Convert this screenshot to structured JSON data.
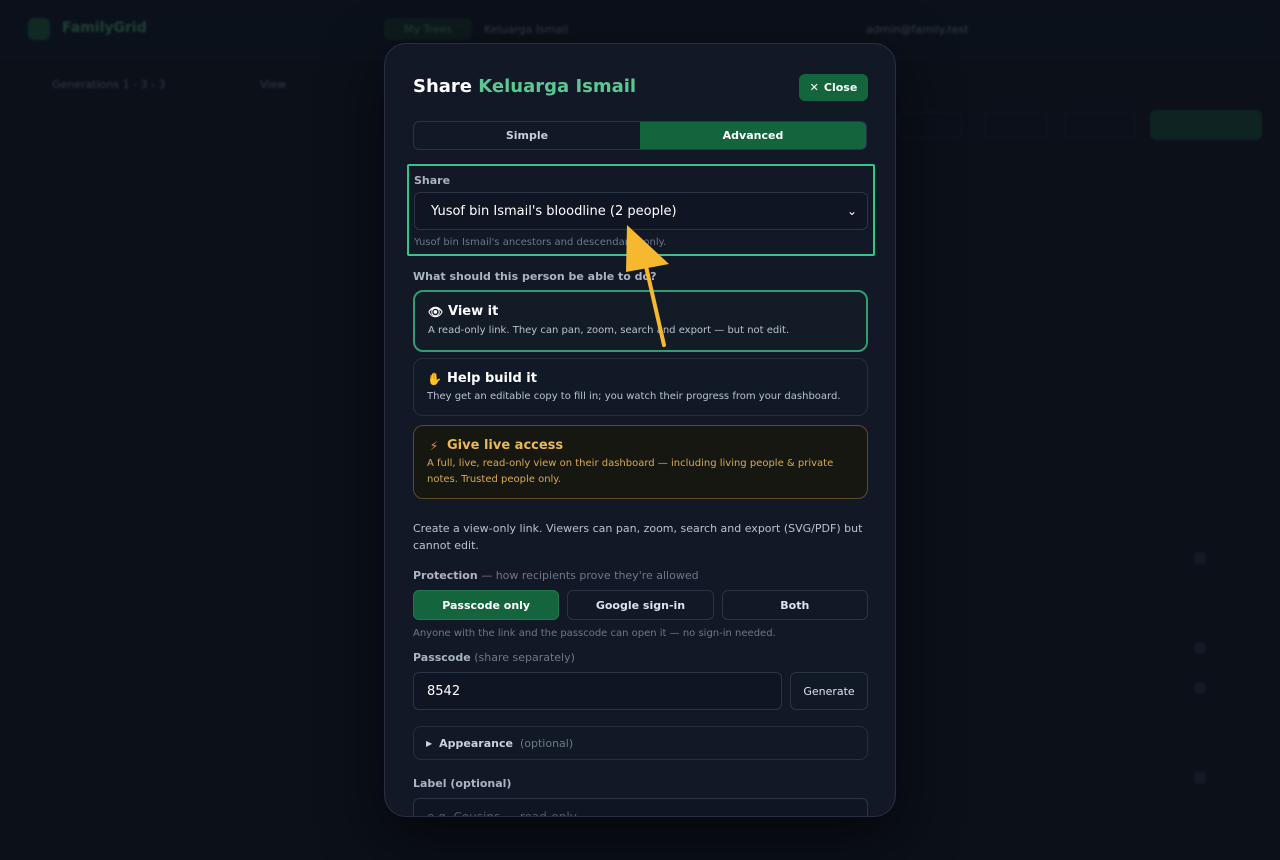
{
  "background": {
    "brand": "FamilyGrid",
    "pill": "My Trees",
    "tree_name": "Keluarga Ismail",
    "user": "admin@family.test",
    "toolbar": [
      "Generations 1 - 3 - 3",
      "View"
    ]
  },
  "modal": {
    "title_prefix": "Share",
    "title_tree": "Keluarga Ismail",
    "close_label": "Close",
    "tabs": [
      "Simple",
      "Advanced"
    ],
    "active_tab": "Advanced",
    "share_label": "Share",
    "share_selected": "Yusof bin Ismail's bloodline (2 people)",
    "share_help": "Yusof bin Ismail's ancestors and descendants only.",
    "question": "What should this person be able to do?",
    "options": [
      {
        "icon": "eye-icon",
        "glyph": "👁",
        "title": "View it",
        "desc": "A read-only link. They can pan, zoom, search and export — but not edit."
      },
      {
        "icon": "hand-icon",
        "glyph": "✋",
        "title": "Help build it",
        "desc": "They get an editable copy to fill in; you watch their progress from your dashboard."
      },
      {
        "icon": "lightning-icon",
        "glyph": "⚡",
        "title": "Give live access",
        "desc": "A full, live, read-only view on their dashboard — including living people & private notes. Trusted people only."
      }
    ],
    "mode_description": "Create a view-only link. Viewers can pan, zoom, search and export (SVG/PDF) but cannot edit.",
    "protection_label": "Protection",
    "protection_hint": "— how recipients prove they're allowed",
    "protection_options": [
      "Passcode only",
      "Google sign-in",
      "Both"
    ],
    "protection_selected": "Passcode only",
    "protection_help": "Anyone with the link and the passcode can open it — no sign-in needed.",
    "passcode_label": "Passcode",
    "passcode_hint": "(share separately)",
    "passcode_value": "8542",
    "generate_label": "Generate",
    "appearance_label": "Appearance",
    "appearance_hint": "(optional)",
    "label_label": "Label (optional)",
    "label_placeholder": "e.g. Cousins — read-only"
  },
  "colors": {
    "accent": "#14653e",
    "highlight": "#36c48a",
    "arrow": "#f5b82e",
    "warn": "#e9b85a"
  }
}
